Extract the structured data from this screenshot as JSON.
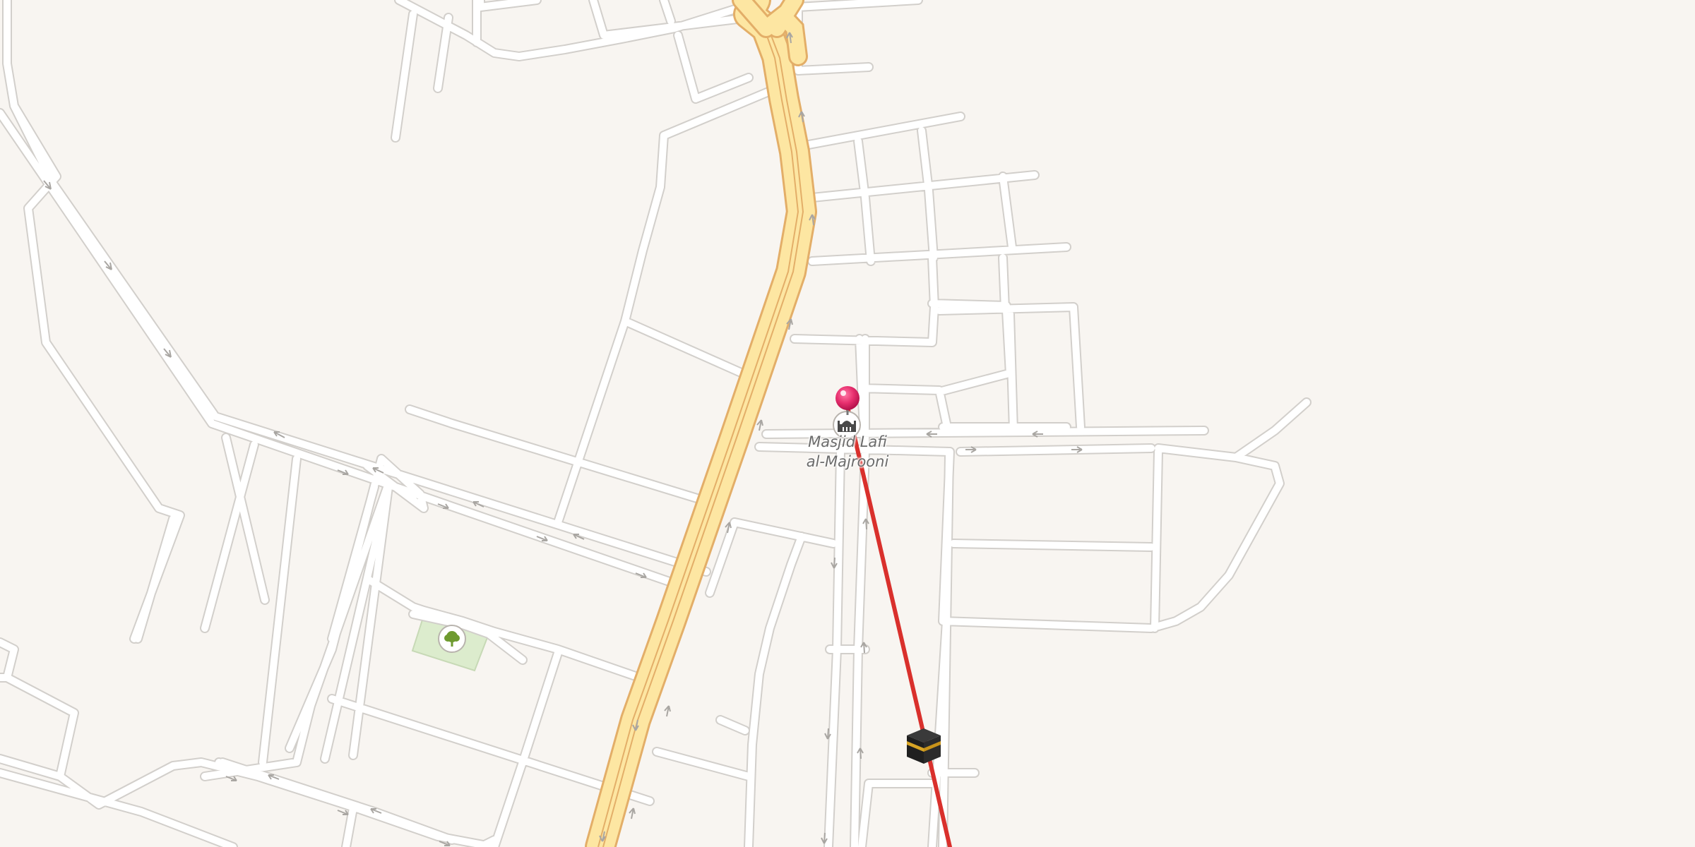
{
  "map": {
    "colors": {
      "land": "#f8f5f1",
      "road": "#ffffff",
      "road_casing": "#d2cfcb",
      "primary_road": "#fde6a2",
      "primary_casing": "#e3ae68",
      "park": "#dceccd",
      "route_line": "#d9302c",
      "pin": "#e8306f",
      "one_way_arrow": "#a9a6a2"
    },
    "poi": {
      "name_line1": "Masjid Lafi",
      "name_line2": "al-Majrooni",
      "icon": "mosque-icon"
    },
    "markers": {
      "selected_pin": "location-pin-icon",
      "qibla_marker": "kaaba-icon",
      "park_marker": "tree-icon"
    },
    "route_line": "qibla-direction-line"
  }
}
